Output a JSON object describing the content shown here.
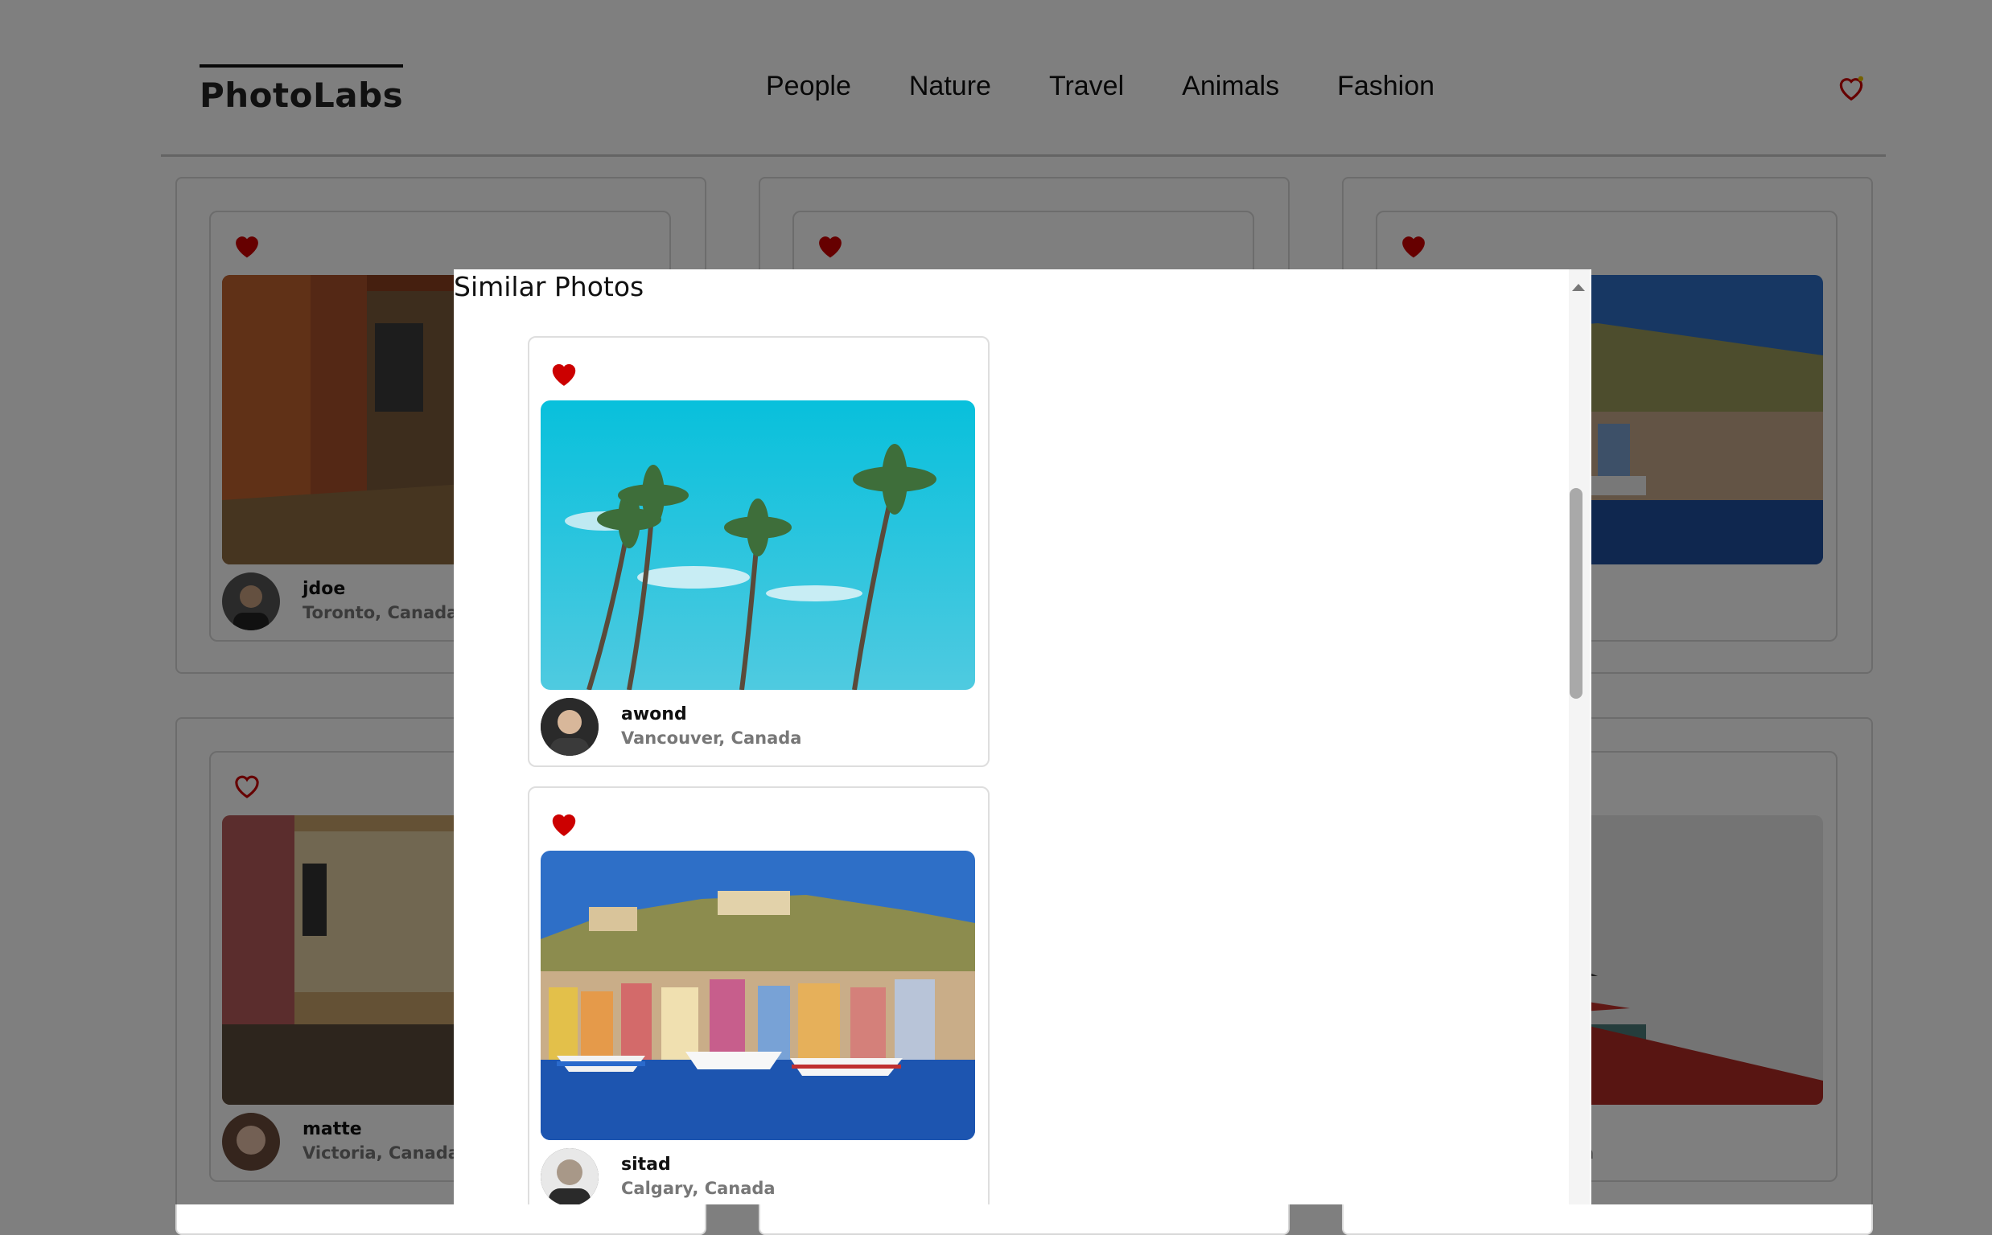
{
  "app": {
    "logo": "PhotoLabs"
  },
  "nav": {
    "topics": [
      "People",
      "Nature",
      "Travel",
      "Animals",
      "Fashion"
    ],
    "favorites_icon": "heart-outline-icon"
  },
  "background_cards": [
    {
      "username": "jdoe",
      "location": "Toronto, Canada",
      "favorited": true
    },
    {
      "username": "",
      "location": "",
      "favorited": true
    },
    {
      "username": "",
      "location": "a",
      "favorited": true
    },
    {
      "username": "matte",
      "location": "Victoria, Canada",
      "favorited": false
    },
    {
      "username": "",
      "location": "",
      "favorited": false
    },
    {
      "username": "",
      "location": "da",
      "favorited": false
    }
  ],
  "modal": {
    "title": "Similar Photos",
    "photos": [
      {
        "username": "awond",
        "location": "Vancouver, Canada",
        "favorited": true,
        "subject": "palm trees"
      },
      {
        "username": "sitad",
        "location": "Calgary, Canada",
        "favorited": true,
        "subject": "harbor town"
      }
    ]
  },
  "colors": {
    "heart": "#cc0000",
    "location_text": "#777777",
    "overlay": "rgba(0,0,0,0.5)"
  }
}
